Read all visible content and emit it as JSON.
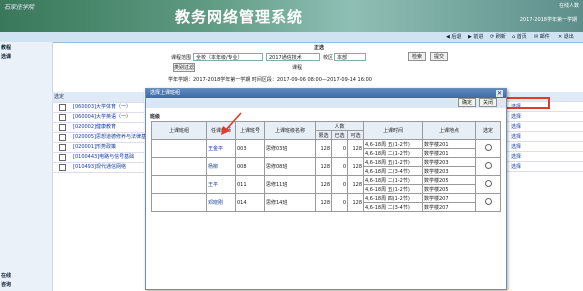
{
  "header": {
    "logo": "石家庄学院",
    "title": "教务网络管理系统",
    "user": "在线人数",
    "term": "2017-2018学年第一学期"
  },
  "toolbar": {
    "items": [
      "◀ 后退",
      "▶ 前进",
      "⟳ 刷新",
      "⌂ 首页",
      "✉ 邮件",
      "✕ 退出"
    ]
  },
  "sidebar": {
    "items": [
      "教程",
      "选课",
      "在线",
      "咨询"
    ]
  },
  "form": {
    "heading": "正选",
    "range_label": "课程范围",
    "range_value": "全校（本年级/专业）",
    "course_type_value": "2017通信技术",
    "campus_label": "校区",
    "campus_value": "本部",
    "check_button": "检索",
    "submit_button": "提交",
    "course_label": "课程",
    "filter_button": "类别过滤",
    "info": "学年学期：2017-2018学年第一学期   时间区段：2017-09-06 08:00—2017-09-14 16:00"
  },
  "course_table": {
    "header": "选定",
    "rows": [
      "[060003]大学体育（一）",
      "[060004]大学英语（一）",
      "[020002]健康教育",
      "[020005]思想道德修养与法律基础",
      "[020001]形势政策",
      "[0100443]电路与信号基础",
      "[010493]现代通信网络"
    ]
  },
  "right_col": {
    "rows": [
      "选择",
      "选择",
      "选择",
      "选择",
      "选择",
      "选择",
      "选择"
    ]
  },
  "dialog": {
    "title": "选择上课班组",
    "confirm_button": "确定",
    "close_button": "关闭",
    "close_icon": "✕",
    "section": "班级",
    "columns": {
      "class_group": "上课班组",
      "teacher": "任课教师",
      "class_no": "上课班号",
      "class_name": "上课班级名称",
      "count_group": "人数",
      "limit": "限选",
      "selected": "已选",
      "available": "可选",
      "time": "上课时间",
      "place": "上课地点",
      "choose": "选定"
    },
    "rows": [
      {
        "teacher": "王金平",
        "no": "003",
        "name": "思修03班",
        "limit": "128",
        "selected": "0",
        "available": "128",
        "times": [
          "4,6-18周 五(1-2节)",
          "4,6-18周 二(1-2节)"
        ],
        "places": [
          "数学楼201",
          "数学楼201"
        ]
      },
      {
        "teacher": "杨柳",
        "no": "008",
        "name": "思修08班",
        "limit": "128",
        "selected": "0",
        "available": "128",
        "times": [
          "4,6-18周 五(1-2节)",
          "4,6-18周 二(3-4节)"
        ],
        "places": [
          "数学楼203",
          "数学楼203"
        ]
      },
      {
        "teacher": "王平",
        "no": "011",
        "name": "思修11班",
        "limit": "128",
        "selected": "0",
        "available": "128",
        "times": [
          "4,6-18周 二(1-2节)",
          "4,6-18周 五(1-2节)"
        ],
        "places": [
          "数学楼205",
          "数学楼205"
        ]
      },
      {
        "teacher": "邓晓刚",
        "no": "014",
        "name": "思修14班",
        "limit": "128",
        "selected": "0",
        "available": "128",
        "times": [
          "4,6-18周 四(1-2节)",
          "4,6-18周 二(3-4节)"
        ],
        "places": [
          "数学楼207",
          "数学楼207"
        ]
      }
    ]
  },
  "colors": {
    "accent": "#3d6ba8",
    "highlight": "#e23b2b",
    "link": "#1540a0"
  }
}
